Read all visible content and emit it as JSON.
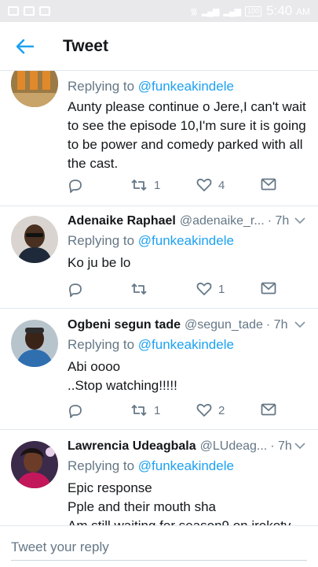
{
  "status_bar": {
    "time": "5:40",
    "ampm": "AM",
    "battery": "100"
  },
  "header": {
    "title": "Tweet"
  },
  "tweets": [
    {
      "replying_prefix": "Replying to ",
      "replying_to": "@funkeakindele",
      "text_lines": [
        "Aunty please continue o Jere,I can't wait",
        "to see the episode 10,I'm sure it is going",
        "to be power and comedy parked with all",
        "the cast."
      ],
      "retweets": "1",
      "likes": "4"
    },
    {
      "name": "Adenaike Raphael",
      "handle": "@adenaike_r...",
      "time": "· 7h",
      "replying_prefix": "Replying to ",
      "replying_to": "@funkeakindele",
      "text_lines": [
        "Ko ju be lo"
      ],
      "retweets": "",
      "likes": "1"
    },
    {
      "name": "Ogbeni segun tade",
      "handle": "@segun_tade",
      "time": "· 7h",
      "replying_prefix": "Replying to ",
      "replying_to": "@funkeakindele",
      "text_lines": [
        "Abi oooo",
        "..Stop watching!!!!!"
      ],
      "retweets": "1",
      "likes": "2"
    },
    {
      "name": "Lawrencia Udeagbala",
      "handle": "@LUdeag...",
      "time": "· 7h",
      "replying_prefix": "Replying to ",
      "replying_to": "@funkeakindele",
      "text_lines": [
        "Epic response",
        "Pple and their mouth sha",
        "Am still waiting for season9 on irokotv"
      ]
    }
  ],
  "compose": {
    "placeholder": "Tweet your reply"
  },
  "colors": {
    "accent": "#1da1f2",
    "muted": "#657786",
    "text": "#14171a",
    "divider": "#e1e8ed"
  },
  "icons": [
    "back-arrow-icon",
    "reply-icon",
    "retweet-icon",
    "like-icon",
    "dm-icon",
    "chevron-down-icon"
  ]
}
